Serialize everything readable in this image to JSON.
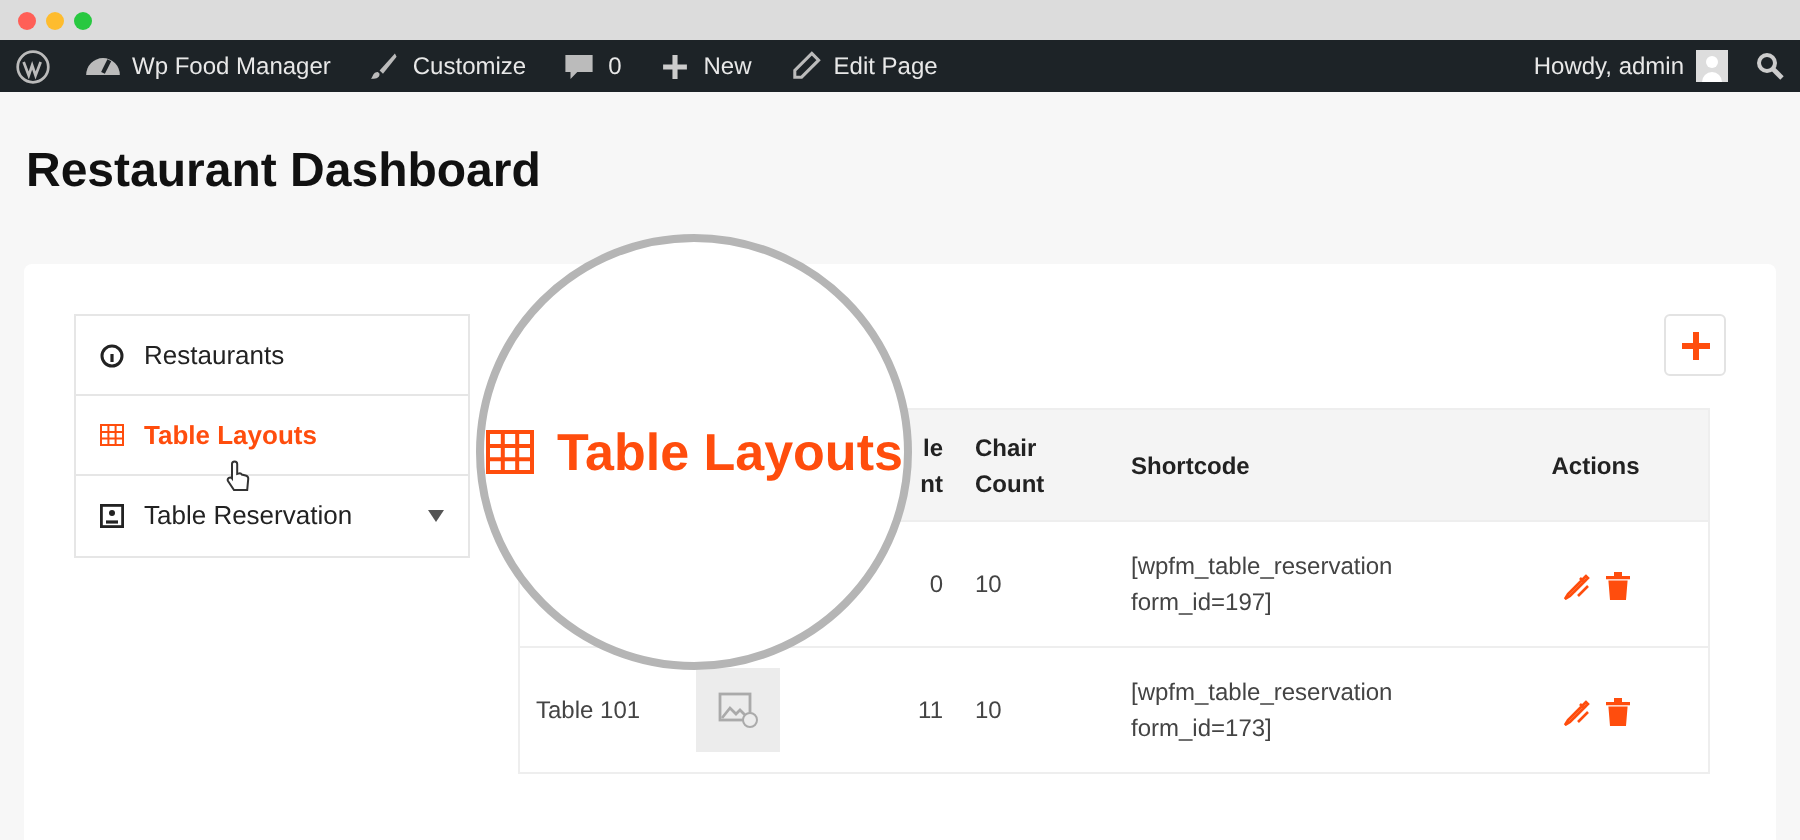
{
  "browser": {
    "dots": [
      {
        "color": "#ff5f57"
      },
      {
        "color": "#febc2e"
      },
      {
        "color": "#28c840"
      }
    ]
  },
  "admin_bar": {
    "items": [
      {
        "kind": "wp"
      },
      {
        "kind": "dashboard",
        "label": "Wp Food Manager"
      },
      {
        "kind": "brush",
        "label": "Customize"
      },
      {
        "kind": "comment",
        "label": "0"
      },
      {
        "kind": "plus",
        "label": "New"
      },
      {
        "kind": "pencil",
        "label": "Edit Page"
      }
    ],
    "user": "Howdy, admin"
  },
  "page_title": "Restaurant Dashboard",
  "sidebar": {
    "items": [
      {
        "kind": "info",
        "label": "Restaurants",
        "selected": false,
        "has_submenu": false
      },
      {
        "kind": "grid",
        "label": "Table Layouts",
        "selected": true,
        "has_submenu": false
      },
      {
        "kind": "person",
        "label": "Table Reservation",
        "selected": false,
        "has_submenu": true
      }
    ]
  },
  "magnifier": {
    "label": "Table Layouts"
  },
  "table": {
    "columns": [
      "le\nnt",
      "Chair Count",
      "Shortcode",
      "Actions"
    ],
    "rows": [
      {
        "cells": [
          "0",
          "10",
          "[wpfm_table_reservation form_id=197]"
        ]
      },
      {
        "name": "Table 101",
        "image": true,
        "cells": [
          "11",
          "10",
          "[wpfm_table_reservation form_id=173]"
        ]
      }
    ]
  }
}
